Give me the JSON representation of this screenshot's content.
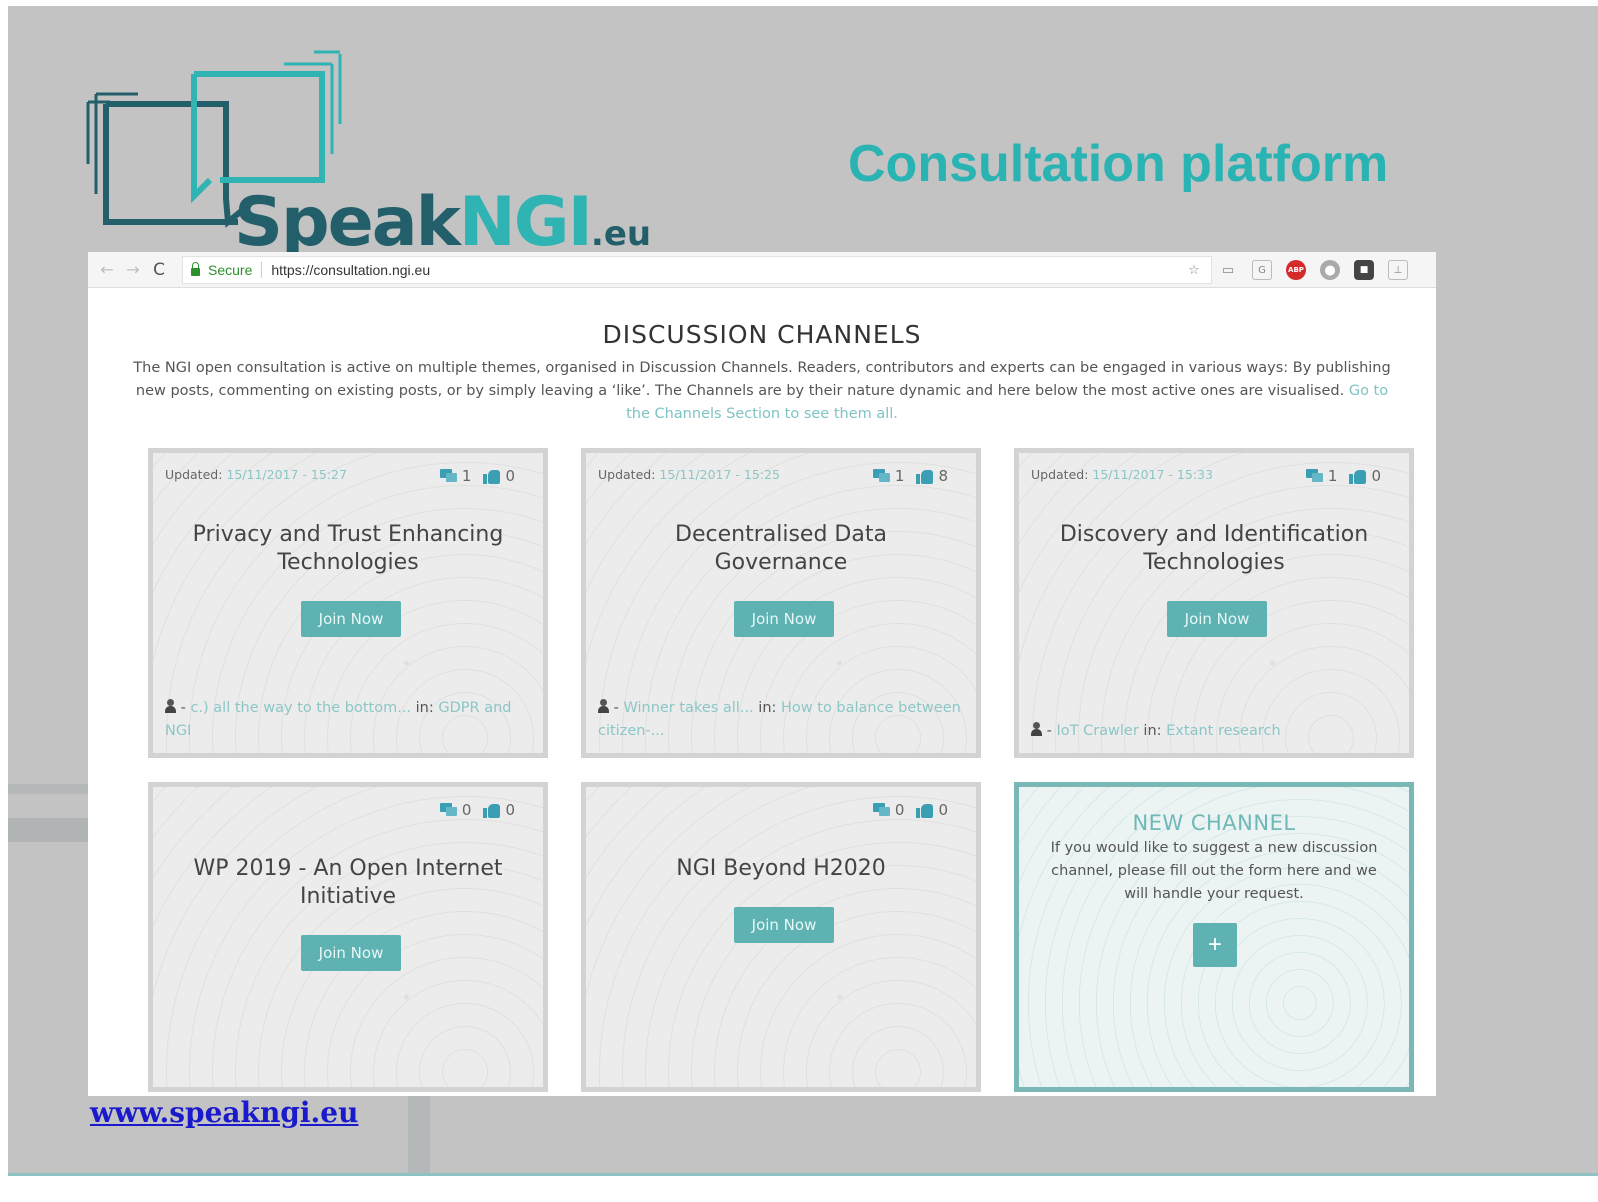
{
  "slide": {
    "title": "Consultation platform",
    "footer_link": "www.speakngi.eu"
  },
  "logo": {
    "speak": "Speak",
    "ngi": "NGI",
    "eu": ".eu"
  },
  "browser": {
    "secure_label": "Secure",
    "url": "https://consultation.ngi.eu",
    "extension_icons": [
      "star-icon",
      "cast-icon",
      "grammarly-icon",
      "adblock-plus-icon",
      "privacy-badger-icon",
      "extension-icon",
      "pdf-icon"
    ]
  },
  "page": {
    "heading": "DISCUSSION CHANNELS",
    "intro_text": "The NGI open consultation is active on multiple themes, organised in Discussion Channels. Readers, contributors and experts can be engaged in various ways: By publishing new posts, commenting on existing posts, or by simply leaving a ‘like’. The Channels are by their nature dynamic and here below the most active ones are visualised.",
    "intro_link": "Go to the Channels Section to see them all."
  },
  "channels": [
    {
      "updated_label": "Updated:",
      "updated": "15/11/2017 - 15:27",
      "comments": "1",
      "likes": "0",
      "title": "Privacy and Trust Enhancing Technologies",
      "button": "Join Now",
      "post_prefix": " - ",
      "post": "c.) all the way to the bottom...",
      "in_label": " in: ",
      "topic": "GDPR and NGI"
    },
    {
      "updated_label": "Updated:",
      "updated": "15/11/2017 - 15:25",
      "comments": "1",
      "likes": "8",
      "title": "Decentralised Data Governance",
      "button": "Join Now",
      "post_prefix": " - ",
      "post": "Winner takes all...",
      "in_label": " in: ",
      "topic": "How to balance between citizen-..."
    },
    {
      "updated_label": "Updated:",
      "updated": "15/11/2017 - 15:33",
      "comments": "1",
      "likes": "0",
      "title": "Discovery and Identification Technologies",
      "button": "Join Now",
      "post_prefix": " - ",
      "post": "IoT Crawler",
      "in_label": " in: ",
      "topic": "Extant research"
    },
    {
      "comments": "0",
      "likes": "0",
      "title": "WP 2019 - An Open Internet Initiative",
      "button": "Join Now"
    },
    {
      "comments": "0",
      "likes": "0",
      "title": "NGI Beyond H2020",
      "button": "Join Now"
    }
  ],
  "new_channel": {
    "title": "NEW CHANNEL",
    "description": "If you would like to suggest a new discussion channel, please fill out the form here and we will handle your request.",
    "button": "+"
  },
  "colors": {
    "accent": "#5eb2b2",
    "title_teal": "#2ab3b3",
    "logo_dark": "#235f6a",
    "link_blue": "#1a1acc"
  }
}
